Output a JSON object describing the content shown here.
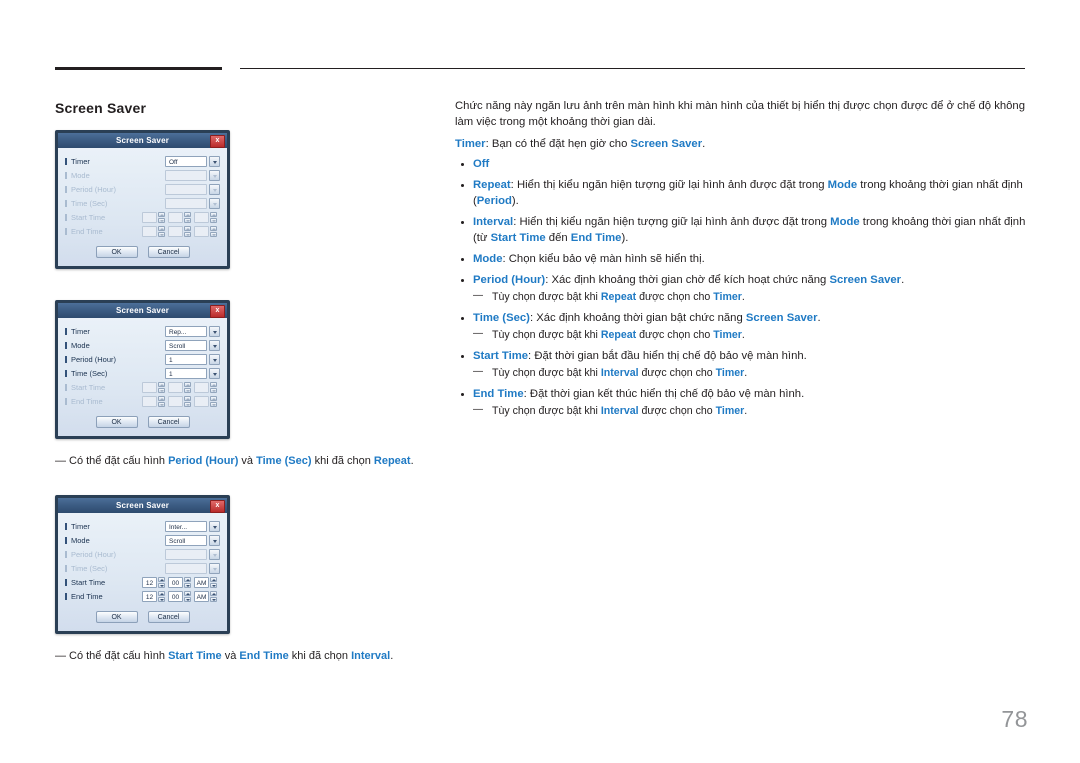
{
  "page": {
    "title": "Screen Saver",
    "number": "78"
  },
  "colors": {
    "accent_blue": "#1f7ac4",
    "text": "#231f20",
    "page_number": "#939598"
  },
  "body": {
    "intro": "Chức năng này ngăn lưu ảnh trên màn hình khi màn hình của thiết bị hiển thị được chọn được để ở chế độ không làm việc trong một khoảng thời gian dài.",
    "timer_line_label": "Timer",
    "timer_line_text": ": Bạn có thể đặt hẹn giờ cho ",
    "timer_line_link": "Screen Saver",
    "timer_line_end": ".",
    "items": [
      {
        "label": "Off",
        "label_type": "link",
        "text": "",
        "sub": []
      },
      {
        "label": "Repeat",
        "label_type": "link",
        "text": ": Hiển thị kiểu ngăn hiện tượng giữ lại hình ảnh được đặt trong ",
        "inline_link": "Mode",
        "text2": " trong khoảng thời gian nhất định (",
        "inline_link2": "Period",
        "text3": ").",
        "sub": []
      },
      {
        "label": "Interval",
        "label_type": "link",
        "text": ": Hiển thị kiểu ngăn hiện tượng giữ lại hình ảnh được đặt trong ",
        "inline_link": "Mode",
        "text2": " trong khoảng thời gian nhất định (từ ",
        "inline_link2": "Start Time",
        "text3": " đến ",
        "inline_link3": "End Time",
        "text4": ").",
        "sub": []
      },
      {
        "label": "Mode",
        "label_type": "link",
        "text": ": Chọn kiểu bảo vệ màn hình sẽ hiển thị.",
        "sub": []
      },
      {
        "label": "Period (Hour)",
        "label_type": "link",
        "text": ": Xác định khoảng thời gian chờ để kích hoạt chức năng ",
        "inline_link": "Screen Saver",
        "text2": ".",
        "sub": [
          {
            "pre": "Tùy chọn được bật khi ",
            "link1": "Repeat",
            "mid": " được chọn cho ",
            "link2": "Timer",
            "post": "."
          }
        ]
      },
      {
        "label": "Time (Sec)",
        "label_type": "link",
        "text": ": Xác định khoảng thời gian bật chức năng ",
        "inline_link": "Screen Saver",
        "text2": ".",
        "sub": [
          {
            "pre": "Tùy chọn được bật khi ",
            "link1": "Repeat",
            "mid": " được chọn cho ",
            "link2": "Timer",
            "post": "."
          }
        ]
      },
      {
        "label": "Start Time",
        "label_type": "link",
        "text": ": Đặt thời gian bắt đầu hiển thị chế độ bảo vệ màn hình.",
        "sub": [
          {
            "pre": "Tùy chọn được bật khi ",
            "link1": "Interval",
            "mid": " được chọn cho ",
            "link2": "Timer",
            "post": "."
          }
        ]
      },
      {
        "label": "End Time",
        "label_type": "link",
        "text": ": Đặt thời gian kết thúc hiển thị chế độ bảo vệ màn hình.",
        "sub": [
          {
            "pre": "Tùy chọn được bật khi ",
            "link1": "Interval",
            "mid": " được chọn cho ",
            "link2": "Timer",
            "post": "."
          }
        ]
      }
    ]
  },
  "dialogs": [
    {
      "id": "dialog-off",
      "title": "Screen Saver",
      "close_label": "x",
      "rows": [
        {
          "label": "Timer",
          "enabled": true,
          "control": "combo",
          "value": "Off"
        },
        {
          "label": "Mode",
          "enabled": false,
          "control": "combo",
          "value": ""
        },
        {
          "label": "Period (Hour)",
          "enabled": false,
          "control": "combo",
          "value": ""
        },
        {
          "label": "Time (Sec)",
          "enabled": false,
          "control": "combo",
          "value": ""
        },
        {
          "label": "Start Time",
          "enabled": false,
          "control": "time",
          "hour": "",
          "minute": "",
          "ampm": ""
        },
        {
          "label": "End Time",
          "enabled": false,
          "control": "time",
          "hour": "",
          "minute": "",
          "ampm": ""
        }
      ],
      "ok": "OK",
      "cancel": "Cancel"
    },
    {
      "id": "dialog-repeat",
      "title": "Screen Saver",
      "close_label": "x",
      "rows": [
        {
          "label": "Timer",
          "enabled": true,
          "control": "combo",
          "value": "Rep..."
        },
        {
          "label": "Mode",
          "enabled": true,
          "control": "combo",
          "value": "Scroll"
        },
        {
          "label": "Period (Hour)",
          "enabled": true,
          "control": "combo",
          "value": "1"
        },
        {
          "label": "Time (Sec)",
          "enabled": true,
          "control": "combo",
          "value": "1"
        },
        {
          "label": "Start Time",
          "enabled": false,
          "control": "time",
          "hour": "",
          "minute": "",
          "ampm": ""
        },
        {
          "label": "End Time",
          "enabled": false,
          "control": "time",
          "hour": "",
          "minute": "",
          "ampm": ""
        }
      ],
      "ok": "OK",
      "cancel": "Cancel"
    },
    {
      "id": "dialog-interval",
      "title": "Screen Saver",
      "close_label": "x",
      "rows": [
        {
          "label": "Timer",
          "enabled": true,
          "control": "combo",
          "value": "Inter..."
        },
        {
          "label": "Mode",
          "enabled": true,
          "control": "combo",
          "value": "Scroll"
        },
        {
          "label": "Period (Hour)",
          "enabled": false,
          "control": "combo",
          "value": ""
        },
        {
          "label": "Time (Sec)",
          "enabled": false,
          "control": "combo",
          "value": ""
        },
        {
          "label": "Start Time",
          "enabled": true,
          "control": "time",
          "hour": "12",
          "minute": "00",
          "ampm": "AM"
        },
        {
          "label": "End Time",
          "enabled": true,
          "control": "time",
          "hour": "12",
          "minute": "00",
          "ampm": "AM"
        }
      ],
      "ok": "OK",
      "cancel": "Cancel"
    }
  ],
  "captions": [
    {
      "pre": "Có thể đặt cấu hình ",
      "link1": "Period (Hour)",
      "mid": " và ",
      "link2": "Time (Sec)",
      "post": " khi đã chọn ",
      "link3": "Repeat",
      "end": "."
    },
    {
      "pre": "Có thể đặt cấu hình ",
      "link1": "Start Time",
      "mid": " và ",
      "link2": "End Time",
      "post": " khi đã chọn ",
      "link3": "Interval",
      "end": "."
    }
  ]
}
